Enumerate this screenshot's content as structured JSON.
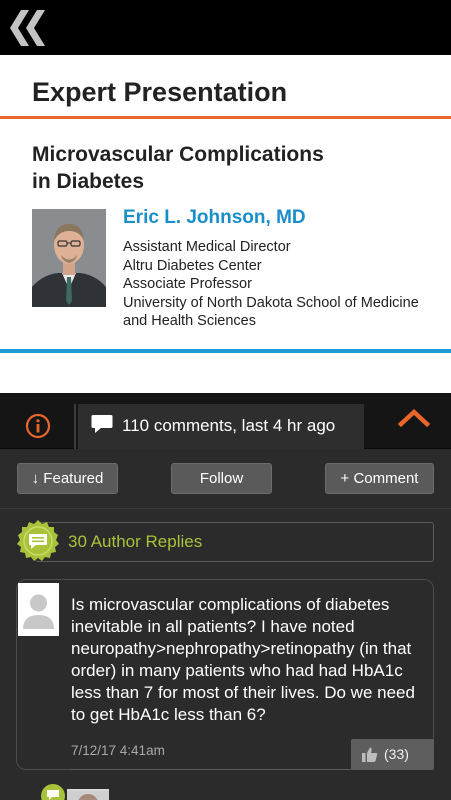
{
  "header": {
    "back_icon": "double-chevron-left-icon"
  },
  "slide": {
    "title": "Expert Presentation",
    "topic_line1": "Microvascular Complications",
    "topic_line2": "in Diabetes",
    "speaker_name": "Eric L. Johnson, MD",
    "credentials": [
      "Assistant Medical Director",
      "Altru Diabetes Center",
      "Associate Professor",
      "University of North Dakota School of Medicine",
      "and Health Sciences"
    ],
    "accent_orange": "#e8662b",
    "accent_blue": "#1e9bd6"
  },
  "tabs": {
    "info_icon": "info-circle-icon",
    "comments_label": "110 comments, last 4 hr ago",
    "comments_icon": "speech-bubble-icon",
    "collapse_icon": "chevron-up-icon"
  },
  "actions": {
    "featured_label": "↓ Featured",
    "follow_label": "Follow",
    "comment_label": "+ Comment"
  },
  "author_replies": {
    "label": "30 Author Replies",
    "icon": "chat-badge-icon",
    "accent": "#a8c23a"
  },
  "comment": {
    "text": "Is microvascular complications of diabetes inevitable in all patients? I have noted neuropathy>nephropathy>retinopathy (in that order) in many patients who had had HbA1c less than 7 for most of their lives. Do we need to get HbA1c less than 6?",
    "date": "7/12/17 4:41am",
    "likes": "(33)",
    "like_icon": "thumbs-up-icon"
  }
}
